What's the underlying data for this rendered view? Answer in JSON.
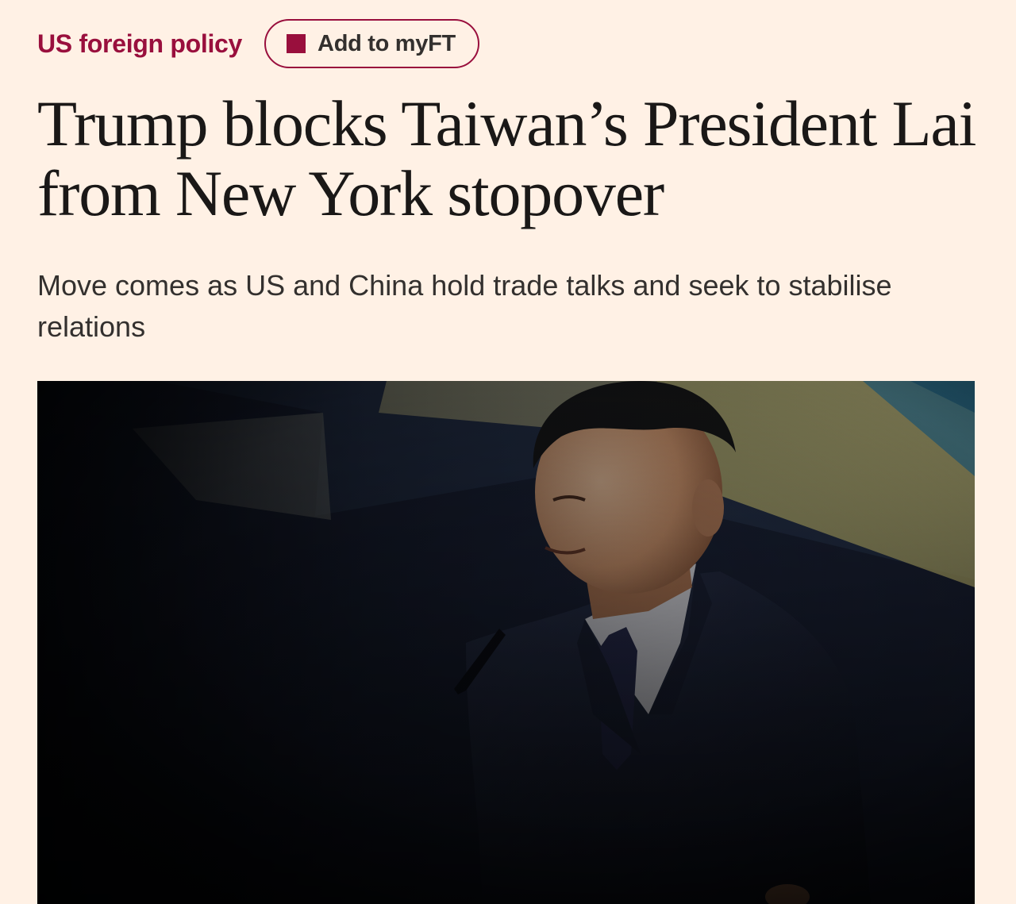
{
  "topic": {
    "label": "US foreign policy"
  },
  "myft": {
    "label": "Add to myFT"
  },
  "article": {
    "headline": "Trump blocks Taiwan’s President Lai from New York stopover",
    "standfirst": "Move comes as US and China hold trade talks and seek to stabilise relations"
  },
  "image": {
    "subject": "man-at-podium-photo"
  },
  "colors": {
    "background": "#FFF1E5",
    "accent": "#990F3D",
    "text": "#33302E",
    "headline": "#1A1817"
  }
}
